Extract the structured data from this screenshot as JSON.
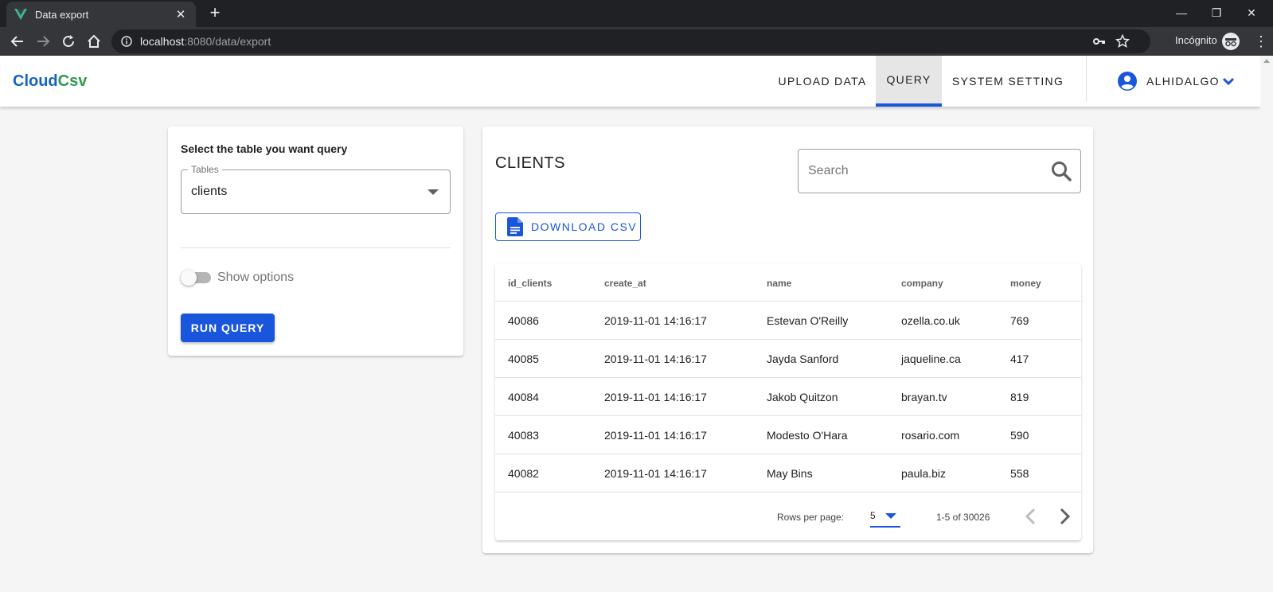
{
  "browser": {
    "tab_title": "Data export",
    "new_tab": "+",
    "url_host": "localhost",
    "url_rest": ":8080/data/export",
    "incognito_label": "Incógnito",
    "window_controls": [
      "—",
      "❐",
      "✕"
    ]
  },
  "app": {
    "logo_part1": "Cloud",
    "logo_part2": "Csv",
    "nav": [
      {
        "label": "UPLOAD DATA"
      },
      {
        "label": "QUERY"
      },
      {
        "label": "SYSTEM SETTING"
      }
    ],
    "user_name": "ALHIDALGO",
    "accent_color": "#1a56db"
  },
  "query_panel": {
    "title": "Select the table you want query",
    "tables_label": "Tables",
    "tables_value": "clients",
    "show_options_label": "Show options",
    "run_label": "RUN QUERY"
  },
  "results": {
    "title": "CLIENTS",
    "search_placeholder": "Search",
    "download_label": "DOWNLOAD CSV",
    "columns": [
      "id_clients",
      "create_at",
      "name",
      "company",
      "money"
    ],
    "rows": [
      [
        "40086",
        "2019-11-01 14:16:17",
        "Estevan O'Reilly",
        "ozella.co.uk",
        "769"
      ],
      [
        "40085",
        "2019-11-01 14:16:17",
        "Jayda Sanford",
        "jaqueline.ca",
        "417"
      ],
      [
        "40084",
        "2019-11-01 14:16:17",
        "Jakob Quitzon",
        "brayan.tv",
        "819"
      ],
      [
        "40083",
        "2019-11-01 14:16:17",
        "Modesto O'Hara",
        "rosario.com",
        "590"
      ],
      [
        "40082",
        "2019-11-01 14:16:17",
        "May Bins",
        "paula.biz",
        "558"
      ]
    ],
    "rows_per_page_label": "Rows per page:",
    "rows_per_page_value": "5",
    "range_text": "1-5 of 30026"
  }
}
